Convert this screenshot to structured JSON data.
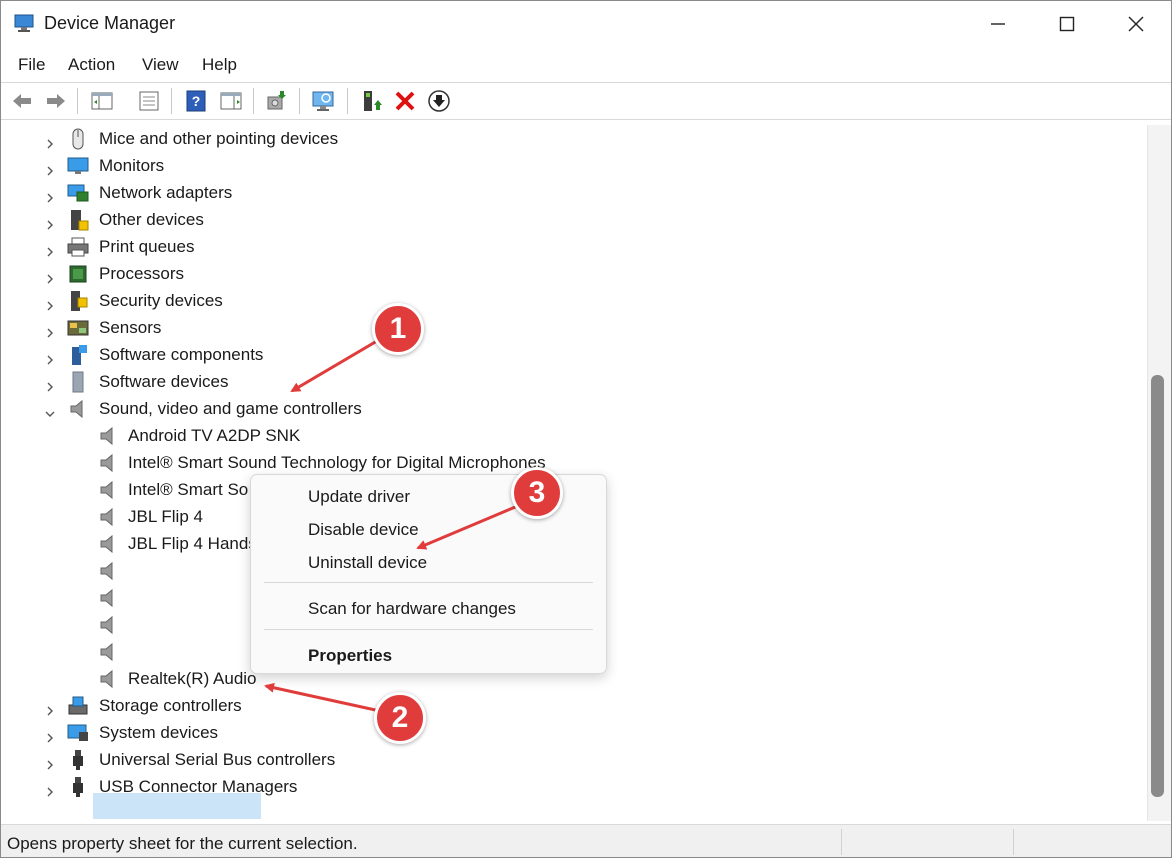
{
  "window": {
    "title": "Device Manager",
    "controls": {
      "minimize": "minimize-icon",
      "maximize": "maximize-icon",
      "close": "close-icon"
    }
  },
  "menu": [
    "File",
    "Action",
    "View",
    "Help"
  ],
  "toolbar": [
    "back-icon",
    "forward-icon",
    "show-hide-tree-icon",
    "properties-icon",
    "help-icon",
    "action-view-icon",
    "update-driver-icon",
    "scan-hardware-icon",
    "enable-device-icon",
    "uninstall-icon",
    "download-icon"
  ],
  "tree": {
    "categories": [
      {
        "label": "Mice and other pointing devices",
        "icon": "mouse-icon",
        "expanded": false
      },
      {
        "label": "Monitors",
        "icon": "monitor-icon",
        "expanded": false
      },
      {
        "label": "Network adapters",
        "icon": "network-icon",
        "expanded": false
      },
      {
        "label": "Other devices",
        "icon": "unknown-device-icon",
        "expanded": false
      },
      {
        "label": "Print queues",
        "icon": "printer-icon",
        "expanded": false
      },
      {
        "label": "Processors",
        "icon": "processor-icon",
        "expanded": false
      },
      {
        "label": "Security devices",
        "icon": "security-icon",
        "expanded": false
      },
      {
        "label": "Sensors",
        "icon": "sensor-icon",
        "expanded": false
      },
      {
        "label": "Software components",
        "icon": "software-component-icon",
        "expanded": false
      },
      {
        "label": "Software devices",
        "icon": "software-device-icon",
        "expanded": false
      },
      {
        "label": "Sound, video and game controllers",
        "icon": "speaker-icon",
        "expanded": true
      }
    ],
    "sound_children": [
      "Android TV A2DP SNK",
      "Intel® Smart Sound Technology for Digital Microphones",
      "Intel® Smart So",
      "JBL Flip 4",
      "JBL Flip 4 Hands",
      "",
      "",
      "",
      "",
      "Realtek(R) Audio"
    ],
    "categories_after": [
      {
        "label": "Storage controllers",
        "icon": "storage-icon",
        "expanded": false
      },
      {
        "label": "System devices",
        "icon": "system-icon",
        "expanded": false
      },
      {
        "label": "Universal Serial Bus controllers",
        "icon": "usb-icon",
        "expanded": false
      },
      {
        "label": "USB Connector Managers",
        "icon": "usb-icon",
        "expanded": false
      }
    ],
    "selected": "Realtek(R) Audio"
  },
  "context_menu": {
    "items": [
      "Update driver",
      "Disable device",
      "Uninstall device"
    ],
    "scan": "Scan for hardware changes",
    "properties": "Properties"
  },
  "status": {
    "text": "Opens property sheet for the current selection."
  },
  "annotations": {
    "badge1": "1",
    "badge2": "2",
    "badge3": "3",
    "color": "#e03c3c"
  }
}
